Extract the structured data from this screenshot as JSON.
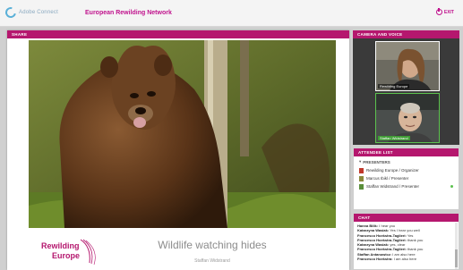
{
  "app": {
    "logo_text": "Adobe Connect",
    "network_name": "European Rewilding Network",
    "exit_label": "EXIT"
  },
  "share": {
    "header": "SHARE",
    "slide_title": "Wildlife watching hides",
    "slide_author": "Staffan Widstrand",
    "logo_line1": "Rewilding",
    "logo_line2": "Europe"
  },
  "camera": {
    "header": "CAMERA AND VOICE",
    "tiles": [
      {
        "name": "Rewilding Europe"
      },
      {
        "name": "Staffan Widstrand"
      }
    ]
  },
  "attendees": {
    "header": "ATTENDEE LIST",
    "group": "PRESENTERS",
    "people": [
      {
        "name": "Rewilding Europe / Organizer",
        "color": "#c0392b",
        "online": false
      },
      {
        "name": "Marcus Ibikl / Presenter",
        "color": "#8a8a3a",
        "online": false
      },
      {
        "name": "Staffan Widstrand / Presenter",
        "color": "#5a8f3a",
        "online": true
      }
    ]
  },
  "chat": {
    "header": "CHAT",
    "messages": [
      {
        "who": "Hanna Bilik:",
        "text": "I hear you"
      },
      {
        "who": "Katarzyna Wasiak:",
        "text": "Yes I hear you well"
      },
      {
        "who": "Francesco Hoekstra-Taglieri:",
        "text": "Yes"
      },
      {
        "who": "Francesco Hoekstra-Taglieri:",
        "text": "thank you"
      },
      {
        "who": "Katarzyna Wasiak:",
        "text": "yes, clear"
      },
      {
        "who": "Francesco Hoekstra-Taglieri:",
        "text": "thank you"
      },
      {
        "who": "Staffan Antanowicz:",
        "text": "I am also here"
      },
      {
        "who": "Francesco Hoekstra:",
        "text": "I am also here"
      }
    ]
  },
  "colors": {
    "accent": "#b5176e",
    "brand": "#c0138d",
    "active_speaker": "#5cc24e"
  }
}
